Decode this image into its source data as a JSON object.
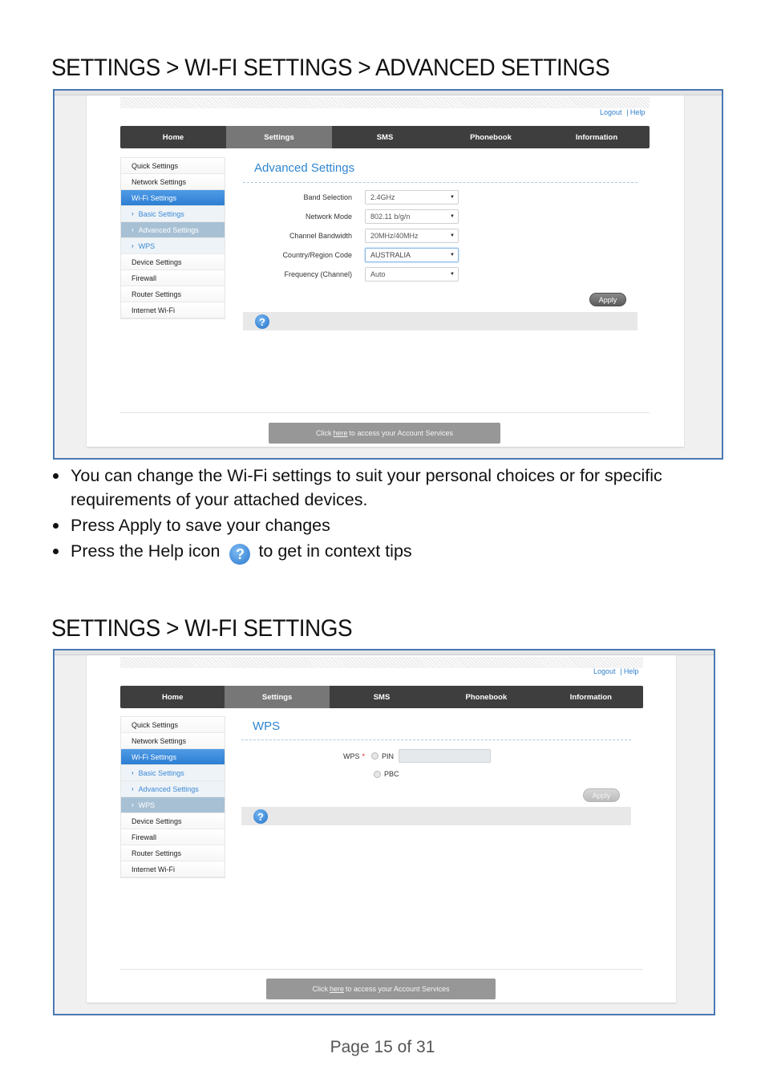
{
  "sections": [
    {
      "title": "SETTINGS > WI-FI SETTINGS > ADVANCED SETTINGS",
      "screenshot": {
        "top_links": {
          "logout": "Logout",
          "help": "Help"
        },
        "nav_tabs": [
          {
            "label": "Home",
            "active": false
          },
          {
            "label": "Settings",
            "active": true
          },
          {
            "label": "SMS",
            "active": false
          },
          {
            "label": "Phonebook",
            "active": false
          },
          {
            "label": "Information",
            "active": false
          }
        ],
        "sidebar": [
          {
            "label": "Quick Settings"
          },
          {
            "label": "Network Settings"
          },
          {
            "label": "Wi-Fi Settings"
          },
          {
            "label": "Basic Settings"
          },
          {
            "label": "Advanced Settings"
          },
          {
            "label": "WPS"
          },
          {
            "label": "Device Settings"
          },
          {
            "label": "Firewall"
          },
          {
            "label": "Router Settings"
          },
          {
            "label": "Internet Wi-Fi"
          }
        ],
        "content_title": "Advanced Settings",
        "fields": [
          {
            "label": "Band Selection",
            "value": "2.4GHz"
          },
          {
            "label": "Network Mode",
            "value": "802.11 b/g/n"
          },
          {
            "label": "Channel Bandwidth",
            "value": "20MHz/40MHz"
          },
          {
            "label": "Country/Region Code",
            "value": "AUSTRALIA"
          },
          {
            "label": "Frequency (Channel)",
            "value": "Auto"
          }
        ],
        "apply_label": "Apply",
        "help_glyph": "?",
        "account_text_before": "Click",
        "account_link": "here",
        "account_text_after": "to access your Account Services"
      }
    },
    {
      "title": "SETTINGS > WI-FI SETTINGS",
      "screenshot": {
        "top_links": {
          "logout": "Logout",
          "help": "Help"
        },
        "nav_tabs": [
          {
            "label": "Home"
          },
          {
            "label": "Settings"
          },
          {
            "label": "SMS"
          },
          {
            "label": "Phonebook"
          },
          {
            "label": "Information"
          }
        ],
        "sidebar": [
          {
            "label": "Quick Settings"
          },
          {
            "label": "Network Settings"
          },
          {
            "label": "Wi-Fi Settings"
          },
          {
            "label": "Basic Settings"
          },
          {
            "label": "Advanced Settings"
          },
          {
            "label": "WPS"
          },
          {
            "label": "Device Settings"
          },
          {
            "label": "Firewall"
          },
          {
            "label": "Router Settings"
          },
          {
            "label": "Internet Wi-Fi"
          }
        ],
        "content_title": "WPS",
        "wps_label": "WPS",
        "required_mark": "*",
        "option_pin": "PIN",
        "option_pbc": "PBC",
        "pin_value": "",
        "apply_label": "Apply",
        "help_glyph": "?",
        "account_text_before": "Click",
        "account_link": "here",
        "account_text_after": "to access your Account Services"
      }
    }
  ],
  "bullets": {
    "item1": "You can change the Wi-Fi settings to suit your personal choices or for specific requirements of your attached devices.",
    "item2": "Press Apply to save your changes",
    "item3_before": "Press the Help icon",
    "item3_after": "to get in context tips",
    "help_glyph": "?"
  },
  "footer": {
    "page_label": "Page 15 of 31"
  }
}
